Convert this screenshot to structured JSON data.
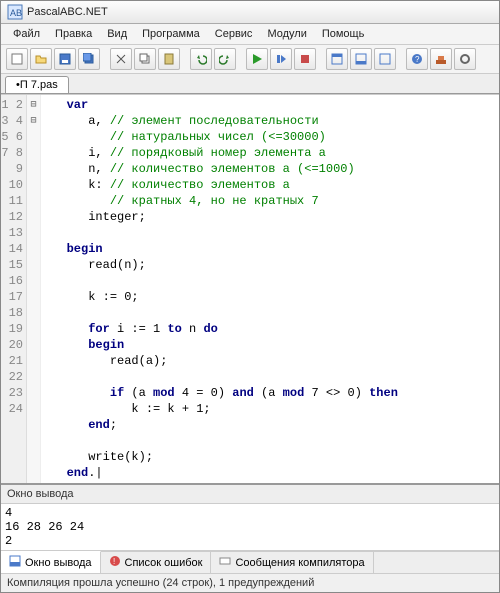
{
  "app": {
    "title": "PascalABC.NET"
  },
  "menu": [
    "Файл",
    "Правка",
    "Вид",
    "Программа",
    "Сервис",
    "Модули",
    "Помощь"
  ],
  "tab": {
    "label": "•П 7.pas"
  },
  "gutter": [
    "1",
    "2",
    "3",
    "4",
    "5",
    "6",
    "7",
    "8",
    "9",
    "10",
    "11",
    "12",
    "13",
    "14",
    "15",
    "16",
    "17",
    "18",
    "19",
    "20",
    "21",
    "22",
    "23",
    "24"
  ],
  "fold": [
    "⊟",
    "",
    "",
    "",
    "",
    "",
    "",
    "",
    "",
    "⊟",
    "",
    "",
    "",
    "",
    "",
    "",
    "",
    "",
    "",
    "",
    "",
    "",
    "",
    ""
  ],
  "code": {
    "l1": {
      "indent": "   ",
      "kw": "var"
    },
    "l2": {
      "indent": "      ",
      "t": "a, ",
      "c": "// элемент последовательности"
    },
    "l3": {
      "indent": "         ",
      "c": "// натуральных чисел (<=30000)"
    },
    "l4": {
      "indent": "      ",
      "t": "i, ",
      "c": "// порядковый номер элемента a"
    },
    "l5": {
      "indent": "      ",
      "t": "n, ",
      "c": "// количество элементов a (<=1000)"
    },
    "l6": {
      "indent": "      ",
      "t": "k: ",
      "c": "// количество элементов a"
    },
    "l7": {
      "indent": "         ",
      "c": "// кратных 4, но не кратных 7"
    },
    "l8": {
      "indent": "      ",
      "t": "integer;"
    },
    "l9": "",
    "l10": {
      "indent": "   ",
      "kw": "begin"
    },
    "l11": {
      "indent": "      ",
      "t": "read(n);"
    },
    "l12": "",
    "l13": {
      "indent": "      ",
      "t": "k := 0;"
    },
    "l14": "",
    "l15": {
      "indent": "      ",
      "kw1": "for",
      "t1": " i := 1 ",
      "kw2": "to",
      "t2": " n ",
      "kw3": "do"
    },
    "l16": {
      "indent": "      ",
      "kw": "begin"
    },
    "l17": {
      "indent": "         ",
      "t": "read(a);"
    },
    "l18": "",
    "l19": {
      "indent": "         ",
      "kw1": "if",
      "t1": " (a ",
      "kw2": "mod",
      "t2": " 4 = 0) ",
      "kw3": "and",
      "t3": " (a ",
      "kw4": "mod",
      "t4": " 7 <> 0) ",
      "kw5": "then"
    },
    "l20": {
      "indent": "            ",
      "t": "k := k + 1;"
    },
    "l21": {
      "indent": "      ",
      "kw": "end",
      "t": ";"
    },
    "l22": "",
    "l23": {
      "indent": "      ",
      "t": "write(k);"
    },
    "l24": {
      "indent": "   ",
      "kw": "end",
      "t": ".|"
    }
  },
  "output": {
    "title": "Окно вывода",
    "body": "4\n16 28 26 24\n2"
  },
  "bottomTabs": {
    "t1": "Окно вывода",
    "t2": "Список ошибок",
    "t3": "Сообщения компилятора"
  },
  "status": "Компиляция прошла успешно (24 строк), 1 предупреждений"
}
